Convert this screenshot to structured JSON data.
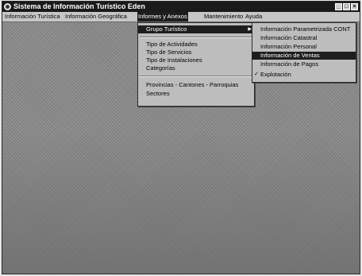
{
  "window": {
    "title": "Sistema de Información Turístico  Eden",
    "controls": [
      "_",
      "□",
      "×"
    ]
  },
  "menubar": {
    "items": [
      {
        "label": "Información Turística"
      },
      {
        "label": "Información Geográfica"
      },
      {
        "label": "Informes y Anexos"
      },
      {
        "label": "Mantenimiento"
      },
      {
        "label": "Ayuda"
      }
    ]
  },
  "main_menu": {
    "items": [
      {
        "label": "Grupo Turístico"
      },
      {
        "label": "Tipo de Actividades"
      },
      {
        "label": "Tipo de Servicios"
      },
      {
        "label": "Tipo de Instalaciones"
      },
      {
        "label": "Categorías"
      },
      {
        "label": "Provincias - Cantones - Parroquias"
      },
      {
        "label": "Sectores"
      }
    ],
    "submenu_arrow": "▶"
  },
  "submenu": {
    "items": [
      {
        "label": "Información Parametrizada  CONT"
      },
      {
        "label": "Información Catastral"
      },
      {
        "label": "Información Personal"
      },
      {
        "label": "Información de Ventas"
      },
      {
        "label": "Información de Pagos"
      },
      {
        "label": "Explotación"
      }
    ],
    "check_mark": "✓"
  }
}
